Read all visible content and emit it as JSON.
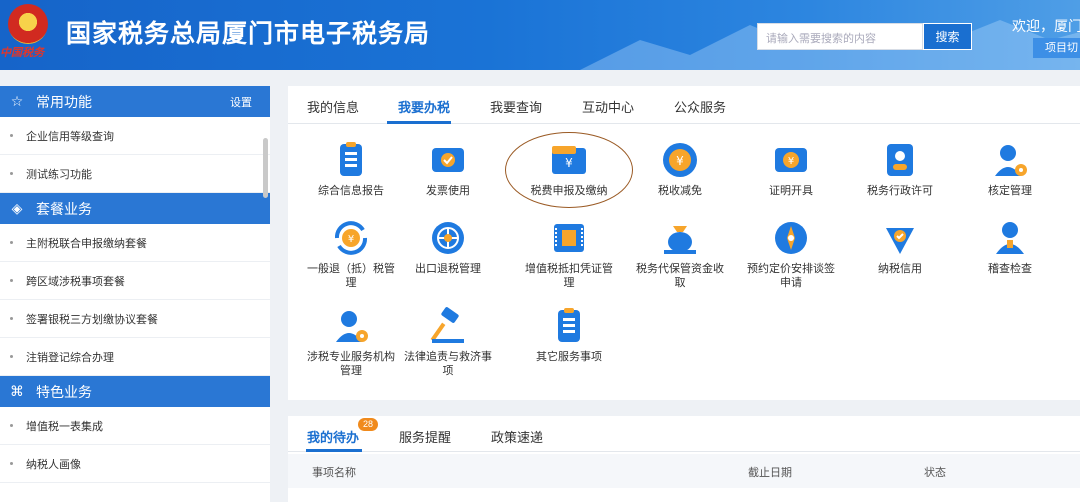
{
  "header": {
    "emblem_script": "中国税务",
    "title": "国家税务总局厦门市电子税务局",
    "search_placeholder": "请输入需要搜索的内容",
    "search_button": "搜索",
    "welcome": "欢迎，厦门",
    "project_button": "项目切"
  },
  "sidebar": {
    "sections": [
      {
        "title": "常用功能",
        "icon": "star-icon",
        "setting": "设置",
        "items": [
          "企业信用等级查询",
          "测试练习功能"
        ]
      },
      {
        "title": "套餐业务",
        "icon": "layers-icon",
        "items": [
          "主附税联合申报缴纳套餐",
          "跨区域涉税事项套餐",
          "签署银税三方划缴协议套餐",
          "注销登记综合办理"
        ]
      },
      {
        "title": "特色业务",
        "icon": "grid-icon",
        "items": [
          "增值税一表集成",
          "纳税人画像"
        ]
      }
    ]
  },
  "main": {
    "tabs": [
      "我的信息",
      "我要办税",
      "我要查询",
      "互动中心",
      "公众服务"
    ],
    "active_tab": "我要办税",
    "services": [
      {
        "label": "综合信息报告",
        "icon": "report-icon"
      },
      {
        "label": "发票使用",
        "icon": "invoice-icon"
      },
      {
        "label": "税费申报及缴纳",
        "icon": "tax-declare-icon"
      },
      {
        "label": "税收减免",
        "icon": "tax-reduce-icon"
      },
      {
        "label": "证明开具",
        "icon": "certificate-icon"
      },
      {
        "label": "税务行政许可",
        "icon": "license-icon"
      },
      {
        "label": "核定管理",
        "icon": "user-gear-icon"
      },
      {
        "label": "一般退（抵）税管理",
        "icon": "refund-icon"
      },
      {
        "label": "出口退税管理",
        "icon": "globe-icon"
      },
      {
        "label": "增值税抵扣凭证管理",
        "icon": "vat-voucher-icon"
      },
      {
        "label": "税务代保管资金收取",
        "icon": "money-bag-icon"
      },
      {
        "label": "预约定价安排谈签申请",
        "icon": "compass-icon"
      },
      {
        "label": "纳税信用",
        "icon": "credit-icon"
      },
      {
        "label": "稽查检查",
        "icon": "inspector-icon"
      },
      {
        "label": "涉税专业服务机构管理",
        "icon": "agency-icon"
      },
      {
        "label": "法律追责与救济事项",
        "icon": "gavel-icon"
      },
      {
        "label": "其它服务事项",
        "icon": "other-icon"
      }
    ]
  },
  "todo": {
    "tabs": [
      "我的待办",
      "服务提醒",
      "政策速递"
    ],
    "badge": "28",
    "columns": [
      "事项名称",
      "截止日期",
      "状态"
    ]
  },
  "colors": {
    "brand": "#1a6fd0",
    "header_bg": "#1a73d6",
    "annotation": "#9a5a24",
    "badge": "#f08a1c"
  }
}
